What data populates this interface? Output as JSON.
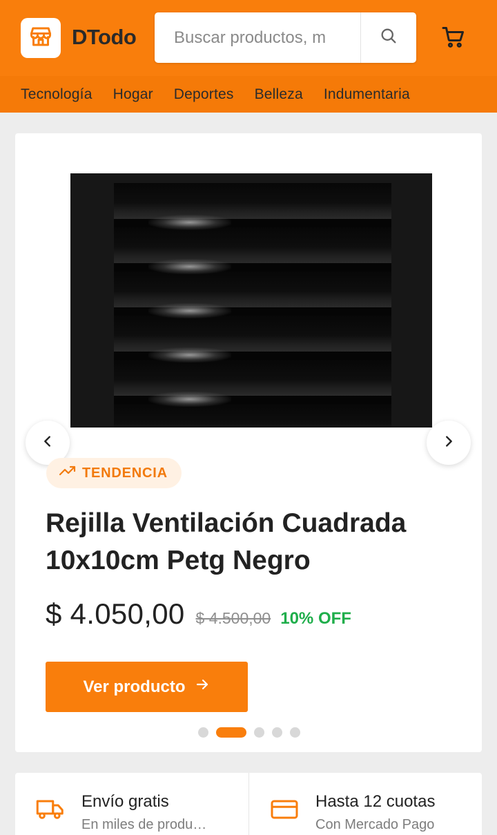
{
  "header": {
    "brand": "DTodo",
    "search_placeholder": "Buscar productos, m",
    "icons": {
      "logo": "store-icon",
      "search": "search-icon",
      "cart": "cart-icon"
    },
    "colors": {
      "primary": "#f97e0c",
      "nav_bar": "#f57a08"
    }
  },
  "categories": [
    "Tecnología",
    "Hogar",
    "Deportes",
    "Belleza",
    "Indumentaria"
  ],
  "product": {
    "badge": "TENDENCIA",
    "title": "Rejilla Ventilación Cuadrada 10x10cm Petg Negro",
    "price": "$ 4.050,00",
    "old_price": "$ 4.500,00",
    "discount": "10% OFF",
    "cta": "Ver producto",
    "carousel": {
      "total_slides": 5,
      "active_index": 1
    },
    "colors": {
      "discount": "#1fae4b",
      "badge_bg": "#fff1e3"
    }
  },
  "features": [
    {
      "icon": "truck-icon",
      "title": "Envío gratis",
      "subtitle": "En miles de produ…"
    },
    {
      "icon": "credit-card-icon",
      "title": "Hasta 12 cuotas",
      "subtitle": "Con Mercado Pago"
    }
  ]
}
